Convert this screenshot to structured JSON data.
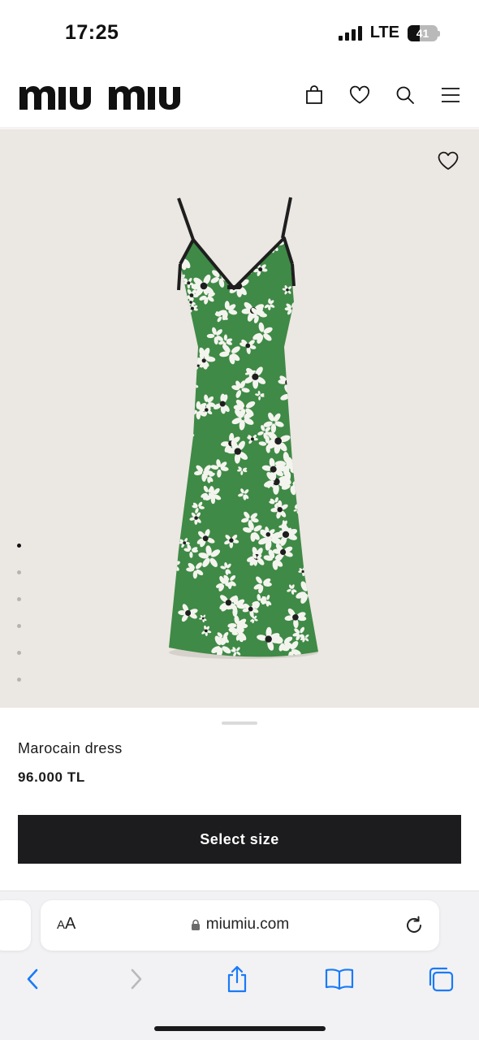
{
  "status_bar": {
    "time": "17:25",
    "network": "LTE",
    "battery_level": "41",
    "battery_fraction": 0.41
  },
  "header": {
    "logo_text": "miu miu",
    "icons": [
      "shopping-bag-icon",
      "heart-icon",
      "search-icon",
      "menu-icon"
    ]
  },
  "product": {
    "name": "Marocain dress",
    "price": "96.000 TL",
    "image_alt": "Marocain dress",
    "carousel": {
      "total": 6,
      "active": 1
    },
    "colors": {
      "fabric": "#3f8a46",
      "print": "#f4f4ee",
      "trim": "#1e1e1e"
    }
  },
  "cta": {
    "label": "Select size"
  },
  "browser": {
    "text_size_label_big": "A",
    "text_size_label_small": "A",
    "url": "miumiu.com",
    "toolbar": [
      "back-icon",
      "forward-icon",
      "share-icon",
      "bookmarks-icon",
      "tabs-icon"
    ],
    "accent": "#1a7af8"
  }
}
